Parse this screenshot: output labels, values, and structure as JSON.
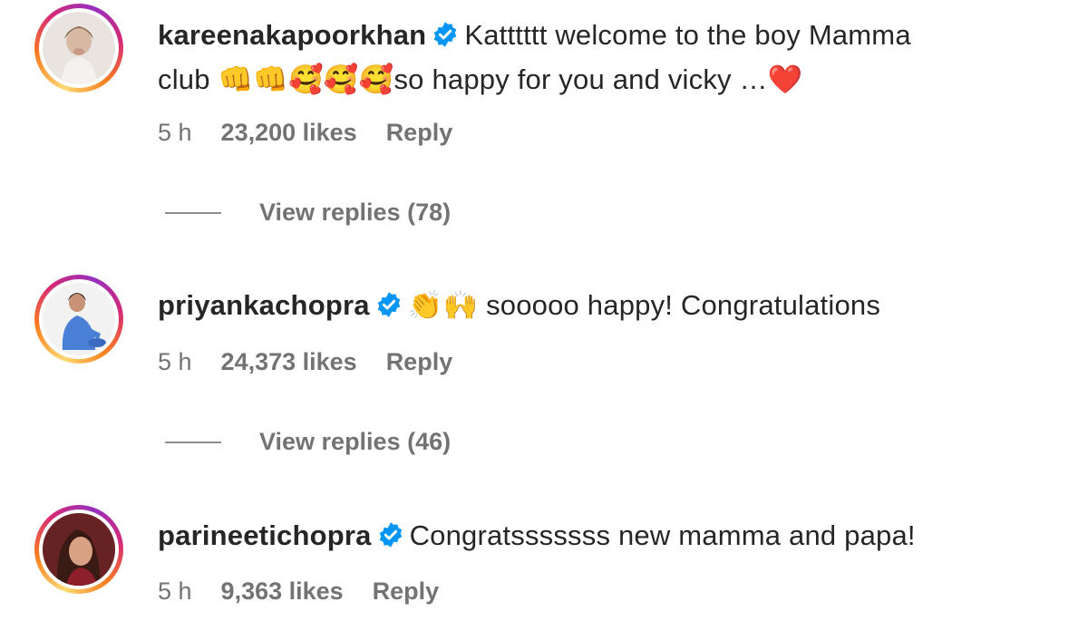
{
  "comments": [
    {
      "username": "kareenakapoorkhan",
      "text_line1": "Katttttt welcome to the boy Mamma",
      "text_line2_prefix": "club ",
      "text_line2_emoji": "👊👊🥰🥰🥰",
      "text_line2_suffix": "so happy for you and vicky …",
      "text_line2_heart": "❤️",
      "time": "5 h",
      "likes": "23,200 likes",
      "reply": "Reply",
      "view_replies": "View replies (78)"
    },
    {
      "username": "priyankachopra",
      "text_emoji": "👏🙌",
      "text": " sooooo happy! Congratulations",
      "time": "5 h",
      "likes": "24,373 likes",
      "reply": "Reply",
      "view_replies": "View replies (46)"
    },
    {
      "username": "parineetichopra",
      "text": "Congratsssssss new mamma and papa!",
      "time": "5 h",
      "likes": "9,363 likes",
      "reply": "Reply"
    }
  ],
  "colors": {
    "verified_badge": "#0095f6",
    "text_primary": "#262626",
    "text_secondary": "#737373"
  }
}
